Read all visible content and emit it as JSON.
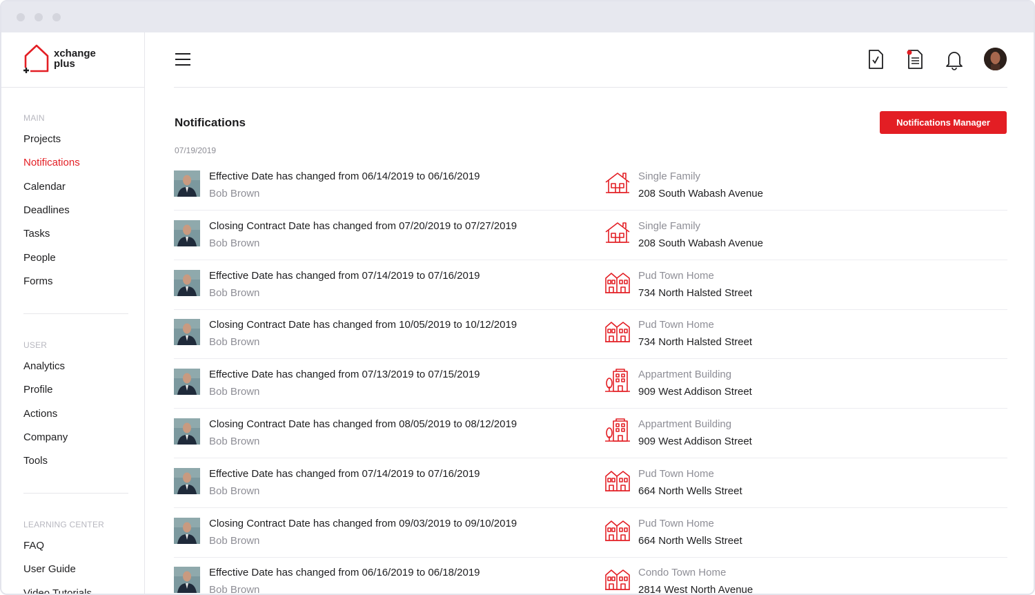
{
  "brand": {
    "line1": "xchange",
    "line2": "plus"
  },
  "colors": {
    "accent": "#e31e24",
    "text": "#1d1d1f",
    "muted": "#8e8e96"
  },
  "sidebar": {
    "sections": [
      {
        "heading": "MAIN",
        "items": [
          {
            "label": "Projects"
          },
          {
            "label": "Notifications",
            "active": true
          },
          {
            "label": "Calendar"
          },
          {
            "label": "Deadlines"
          },
          {
            "label": "Tasks"
          },
          {
            "label": "People"
          },
          {
            "label": "Forms"
          }
        ]
      },
      {
        "heading": "USER",
        "items": [
          {
            "label": "Analytics"
          },
          {
            "label": "Profile"
          },
          {
            "label": "Actions"
          },
          {
            "label": "Company"
          },
          {
            "label": "Tools"
          }
        ]
      },
      {
        "heading": "LEARNING CENTER",
        "items": [
          {
            "label": "FAQ"
          },
          {
            "label": "User Guide"
          },
          {
            "label": "Video Tutorials"
          }
        ]
      }
    ]
  },
  "header": {
    "icons": [
      "menu-icon",
      "checklist-document-icon",
      "document-notification-icon",
      "bell-icon",
      "user-avatar"
    ]
  },
  "main": {
    "title": "Notifications",
    "manager_button": "Notifications Manager",
    "date": "07/19/2019",
    "notifications": [
      {
        "message": "Effective Date has changed from 06/14/2019 to 06/16/2019",
        "user": "Bob Brown",
        "property_icon": "single-family-house-icon",
        "property_type": "Single Family",
        "address": "208 South Wabash Avenue"
      },
      {
        "message": "Closing Contract Date has changed from 07/20/2019 to 07/27/2019",
        "user": "Bob Brown",
        "property_icon": "single-family-house-icon",
        "property_type": "Single Family",
        "address": "208 South Wabash Avenue"
      },
      {
        "message": "Effective Date has changed from 07/14/2019 to 07/16/2019",
        "user": "Bob Brown",
        "property_icon": "townhome-icon",
        "property_type": "Pud Town Home",
        "address": "734 North Halsted Street"
      },
      {
        "message": "Closing Contract Date has changed from 10/05/2019 to 10/12/2019",
        "user": "Bob Brown",
        "property_icon": "townhome-icon",
        "property_type": "Pud Town Home",
        "address": "734 North Halsted Street"
      },
      {
        "message": "Effective Date has changed from 07/13/2019 to 07/15/2019",
        "user": "Bob Brown",
        "property_icon": "apartment-building-icon",
        "property_type": "Appartment Building",
        "address": "909 West Addison Street"
      },
      {
        "message": "Closing Contract Date has changed from 08/05/2019 to 08/12/2019",
        "user": "Bob Brown",
        "property_icon": "apartment-building-icon",
        "property_type": "Appartment Building",
        "address": "909 West Addison Street"
      },
      {
        "message": "Effective Date has changed from 07/14/2019 to 07/16/2019",
        "user": "Bob Brown",
        "property_icon": "townhome-icon",
        "property_type": "Pud Town Home",
        "address": "664 North Wells Street"
      },
      {
        "message": "Closing Contract Date has changed from 09/03/2019 to 09/10/2019",
        "user": "Bob Brown",
        "property_icon": "townhome-icon",
        "property_type": "Pud Town Home",
        "address": "664 North Wells Street"
      },
      {
        "message": "Effective Date has changed from 06/16/2019 to 06/18/2019",
        "user": "Bob Brown",
        "property_icon": "townhome-icon",
        "property_type": "Condo Town Home",
        "address": "2814 West North Avenue"
      }
    ]
  }
}
